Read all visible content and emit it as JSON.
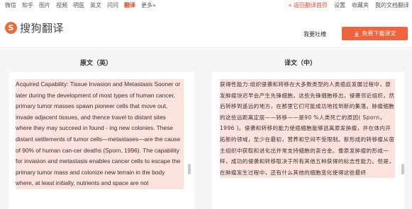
{
  "topnav": {
    "links": [
      "微信",
      "知乎",
      "图片",
      "视频",
      "明医",
      "英文",
      "问问",
      "翻译",
      "更多»"
    ],
    "active_index": 7,
    "right_links": [
      "« 返回翻译首页",
      "设置",
      "收藏夹",
      "我的文档翻译"
    ]
  },
  "header": {
    "logo_mark": "S",
    "logo_text": "搜狗翻译",
    "feedback": "我要吐槽",
    "download_icon": "download-arrow-icon",
    "download_label": "免费下载译文"
  },
  "columns": {
    "source_title": "原文（英）",
    "target_title": "译文（中）"
  },
  "source_text": "Acquired Capability: Tissue Invasion and Metastasis Sooner or later during the development of most types of human cancer, primary tumor masses spawn pioneer cells that move out, invade adjacent tissues, and thence travel to distant sites where they may succeed in found - ing new colonies. These distant settlements of tumor cells—metastases—are the cause of 90% of human can-cer deaths (Sporn, 1996). The capability for invasion and metastasis enables cancer cells to escape the primary tumor mass and colonize new terrain in the body where, at least initially, nutrients and space are not",
  "target_text": "获得性能力:组织侵袭和转移在大多数类型的人类癌症发展过程中，原发肿瘤块迟早会产生先锋细胞，这些先锋细胞移出，侵袭邻近组织，然后转移到遥远的地方，在那里它们可能成功地找到新的集落。肿瘤细胞的这些远距离定居——转移——是90 %人类死亡的原因( Sporn，1996 )。侵袭和转移的能力使癌细胞能够逃离原发肿瘤，并在体内开拓新的领域，至少在最初，营养和空间不受限制。新形成的转移瘤从宿主组织中获取和进化出并常支持细胞的亲合金。像原发肿瘤的形成一样，成功的侵袭和转移取决于所有其他五种获得的标志性能力。但是，在肿瘤发生过程中，还有什么其他的细胞变化使得这些最终"
}
